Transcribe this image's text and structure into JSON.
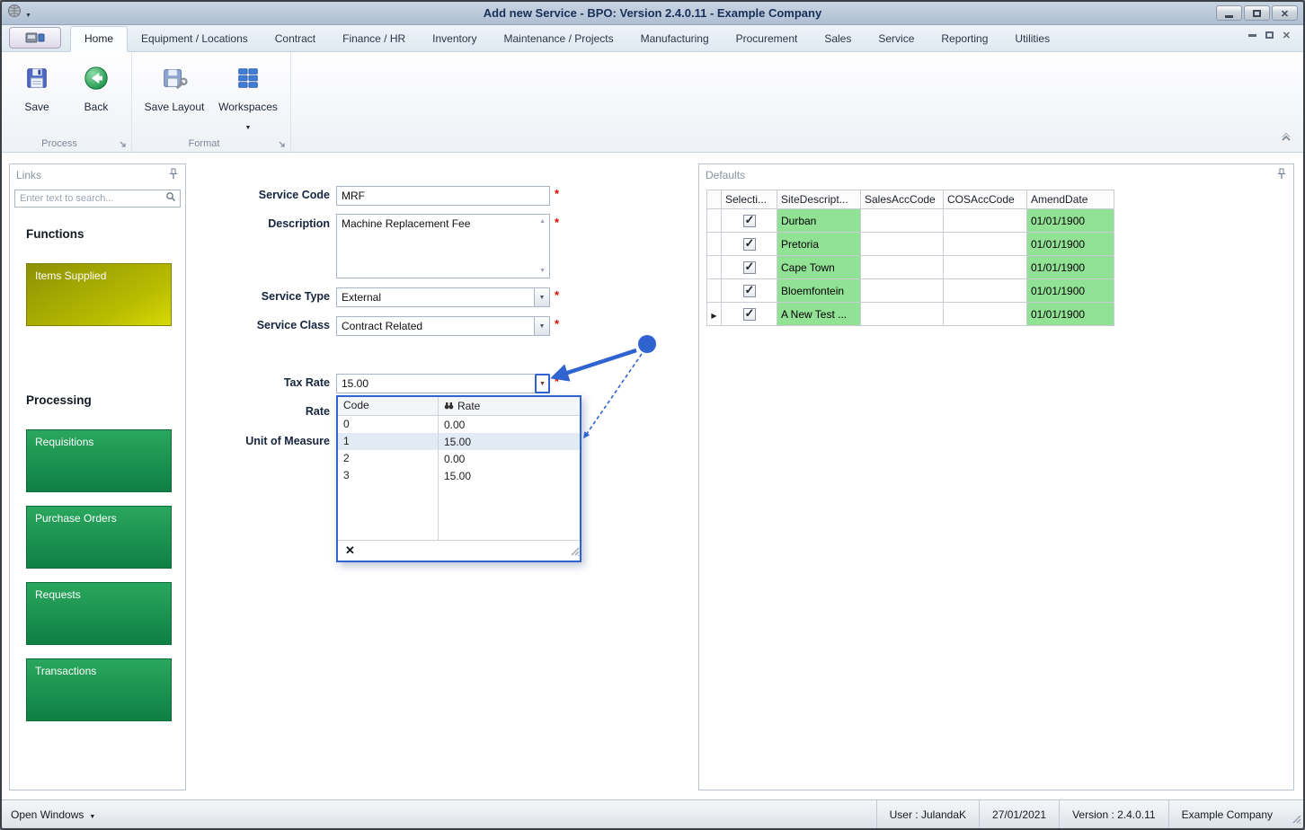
{
  "window": {
    "title": "Add new Service - BPO: Version 2.4.0.11 - Example Company"
  },
  "tabs": [
    {
      "label": "Home"
    },
    {
      "label": "Equipment / Locations"
    },
    {
      "label": "Contract"
    },
    {
      "label": "Finance / HR"
    },
    {
      "label": "Inventory"
    },
    {
      "label": "Maintenance / Projects"
    },
    {
      "label": "Manufacturing"
    },
    {
      "label": "Procurement"
    },
    {
      "label": "Sales"
    },
    {
      "label": "Service"
    },
    {
      "label": "Reporting"
    },
    {
      "label": "Utilities"
    }
  ],
  "ribbon": {
    "save": "Save",
    "back": "Back",
    "save_layout": "Save Layout",
    "workspaces": "Workspaces",
    "groups": {
      "process": "Process",
      "format": "Format"
    }
  },
  "links": {
    "title": "Links",
    "search_placeholder": "Enter text to search...",
    "functions_heading": "Functions",
    "processing_heading": "Processing",
    "function_tiles": [
      {
        "label": "Items Supplied"
      }
    ],
    "processing_tiles": [
      {
        "label": "Requisitions"
      },
      {
        "label": "Purchase Orders"
      },
      {
        "label": "Requests"
      },
      {
        "label": "Transactions"
      }
    ]
  },
  "form": {
    "service_code": {
      "label": "Service Code",
      "value": "MRF"
    },
    "description": {
      "label": "Description",
      "value": "Machine Replacement Fee"
    },
    "service_type": {
      "label": "Service Type",
      "value": "External"
    },
    "service_class": {
      "label": "Service Class",
      "value": "Contract Related"
    },
    "tax_rate": {
      "label": "Tax Rate",
      "value": "15.00"
    },
    "rate": {
      "label": "Rate"
    },
    "unit_of_measure": {
      "label": "Unit of Measure"
    },
    "required_marker": "*"
  },
  "tax_lookup": {
    "columns": {
      "code": "Code",
      "rate": "Rate"
    },
    "selected_index": 1,
    "rows": [
      {
        "code": "0",
        "rate": "0.00"
      },
      {
        "code": "1",
        "rate": "15.00"
      },
      {
        "code": "2",
        "rate": "0.00"
      },
      {
        "code": "3",
        "rate": "15.00"
      }
    ]
  },
  "defaults": {
    "title": "Defaults",
    "columns": {
      "selection": "Selecti...",
      "site": "SiteDescript...",
      "sales": "SalesAccCode",
      "cos": "COSAccCode",
      "amend": "AmendDate"
    },
    "rows": [
      {
        "checked": true,
        "site": "Durban",
        "sales": "",
        "cos": "",
        "amend": "01/01/1900"
      },
      {
        "checked": true,
        "site": "Pretoria",
        "sales": "",
        "cos": "",
        "amend": "01/01/1900"
      },
      {
        "checked": true,
        "site": "Cape Town",
        "sales": "",
        "cos": "",
        "amend": "01/01/1900"
      },
      {
        "checked": true,
        "site": "Bloemfontein",
        "sales": "",
        "cos": "",
        "amend": "01/01/1900"
      },
      {
        "checked": true,
        "site": "A New Test ...",
        "sales": "",
        "cos": "",
        "amend": "01/01/1900",
        "current": true
      }
    ]
  },
  "statusbar": {
    "open_windows": "Open Windows",
    "user": "User : JulandaK",
    "date": "27/01/2021",
    "version": "Version : 2.4.0.11",
    "company": "Example Company"
  },
  "colors": {
    "annotation_blue": "#2f63cf",
    "tile_green_top": "#2aa75e",
    "tile_green_bottom": "#0f7f44",
    "tile_olive": "#b9bd00",
    "grid_green": "#92e295",
    "required_red": "#e00000",
    "titlebar": "#aebfd2"
  },
  "icons": {
    "pin": "pushpin",
    "search": "magnifier",
    "find": "binoculars",
    "dropdown": "caret-down"
  }
}
